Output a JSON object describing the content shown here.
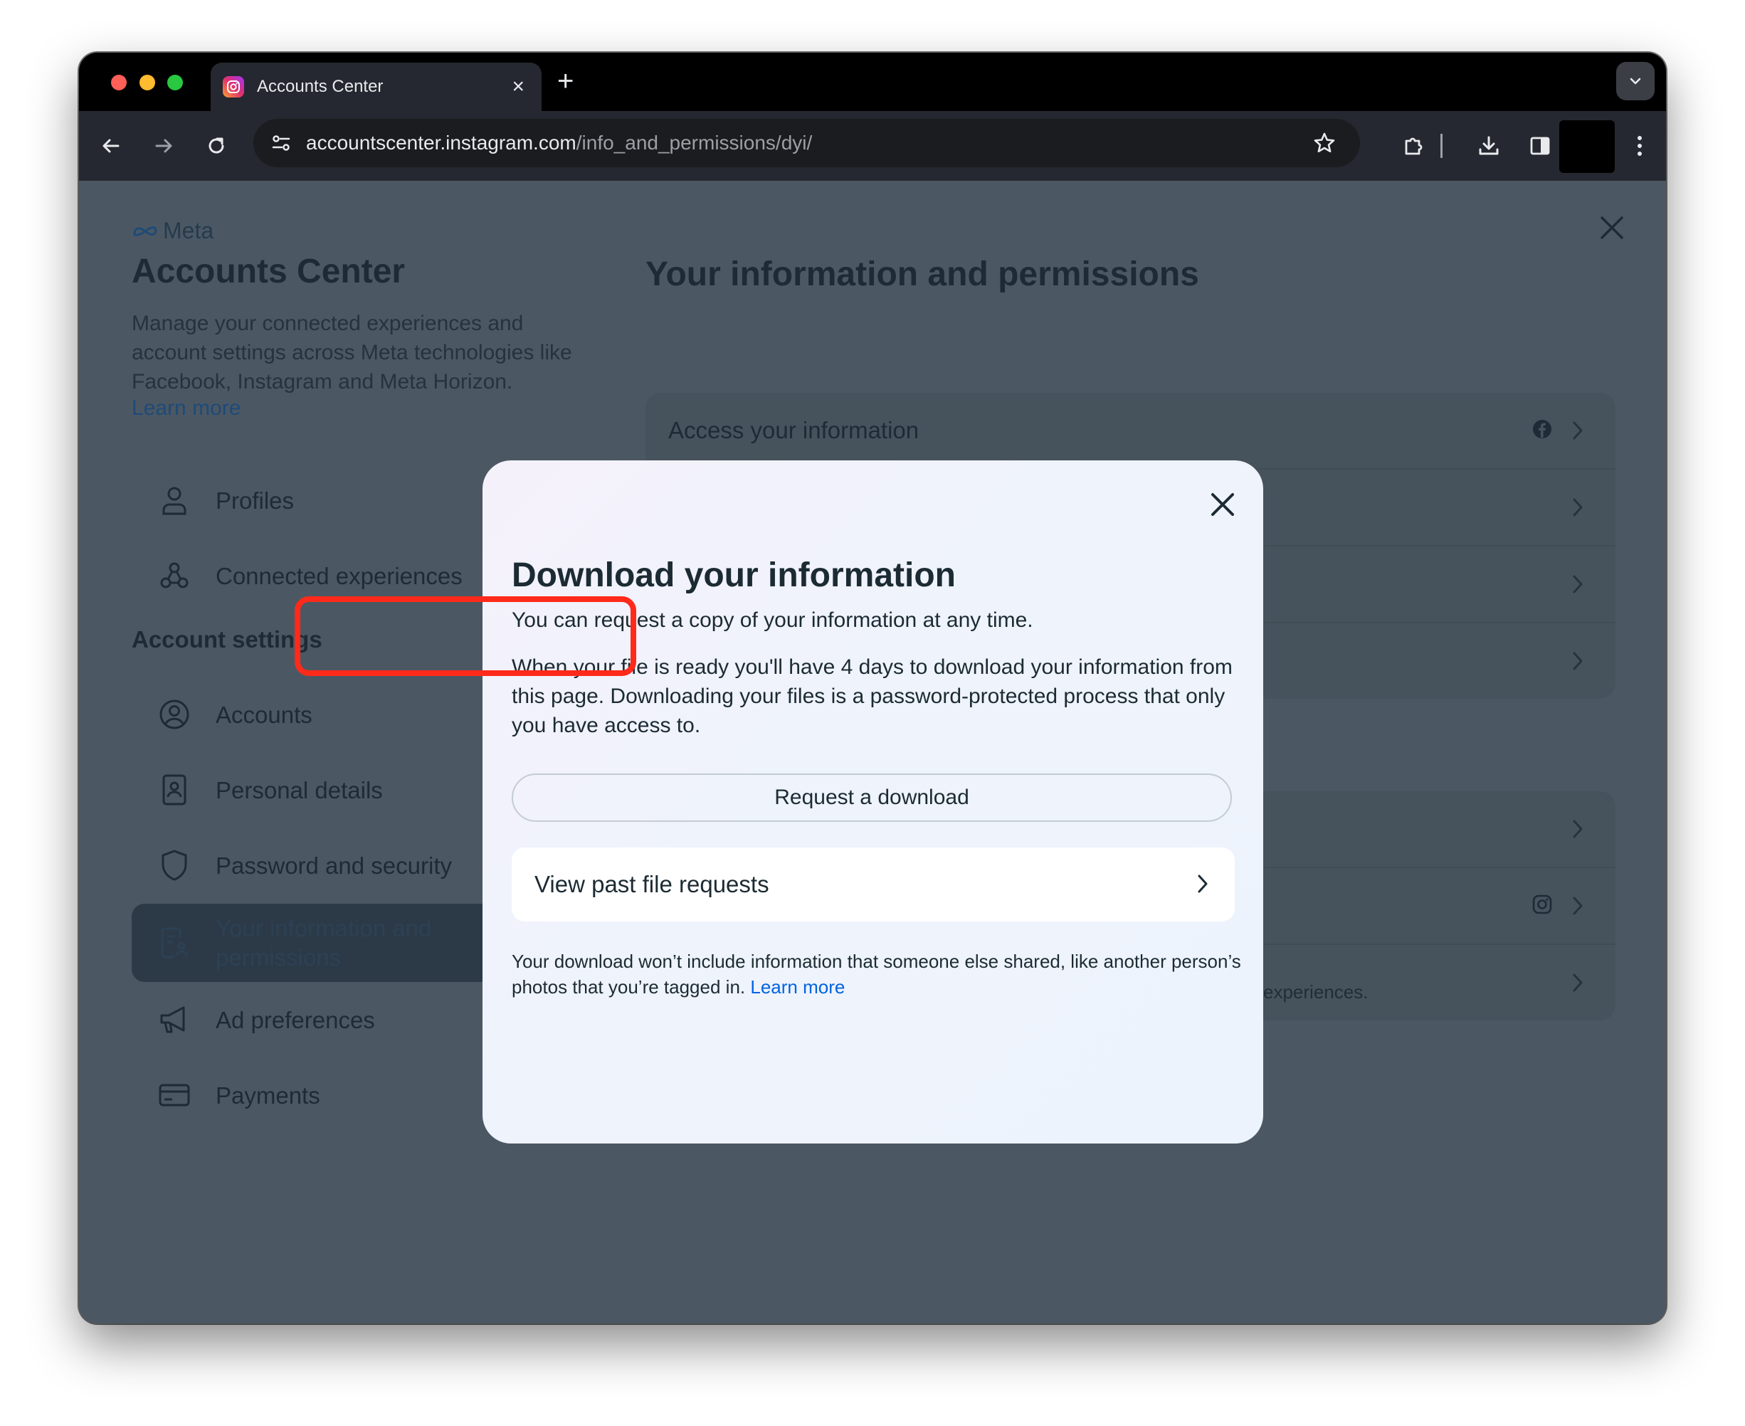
{
  "browser": {
    "tab_title": "Accounts Center",
    "tab_close": "×",
    "new_tab": "+",
    "url_host": "accountscenter.instagram.com",
    "url_path": "/info_and_permissions/dyi/"
  },
  "sidebar": {
    "brand": "Meta",
    "title": "Accounts Center",
    "description": "Manage your connected experiences and account settings across Meta technologies like Facebook, Instagram and Meta Horizon.",
    "learn_more": "Learn more",
    "items_top": [
      {
        "label": "Profiles",
        "icon": "person-icon"
      },
      {
        "label": "Connected experiences",
        "icon": "connected-icon"
      }
    ],
    "section_header": "Account settings",
    "items": [
      {
        "label": "Accounts",
        "icon": "account-circle-icon"
      },
      {
        "label": "Personal details",
        "icon": "id-card-icon"
      },
      {
        "label": "Password and security",
        "icon": "shield-icon"
      },
      {
        "label": "Your information and permissions",
        "icon": "info-permissions-icon",
        "active": true
      },
      {
        "label": "Ad preferences",
        "icon": "megaphone-icon"
      },
      {
        "label": "Payments",
        "icon": "credit-card-icon"
      }
    ]
  },
  "main": {
    "title": "Your information and permissions",
    "first_row": "Access your information",
    "footnote": "experiences."
  },
  "modal": {
    "title": "Download your information",
    "subtitle": "You can request a copy of your information at any time.",
    "body": "When your file is ready you'll have 4 days to download your information from this page. Downloading your files is a password-protected process that only you have access to.",
    "primary_button": "Request a download",
    "past_requests": "View past file requests",
    "footer_text": "Your download won’t include information that someone else shared, like another person’s photos that you’re tagged in. ",
    "footer_link": "Learn more"
  },
  "colors": {
    "overlay": "#4b5863",
    "highlight": "#ff2a1a",
    "link": "#0064e0"
  }
}
